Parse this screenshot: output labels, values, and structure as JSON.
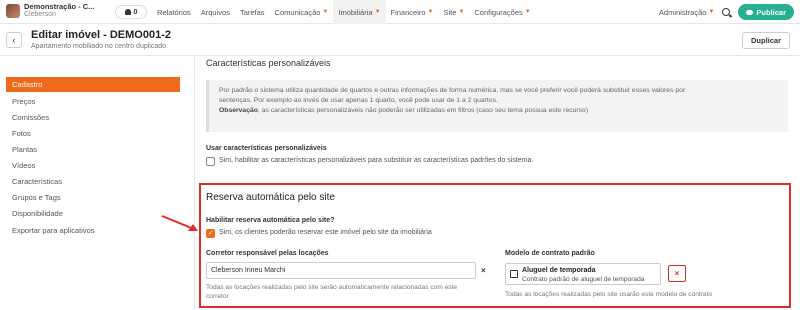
{
  "brand": {
    "title": "Demonstração - C...",
    "subtitle": "Cleberson"
  },
  "notifications": {
    "count": "0"
  },
  "menu": [
    {
      "label": "Relatórios",
      "dropdown": false,
      "active": false
    },
    {
      "label": "Arquivos",
      "dropdown": false,
      "active": false
    },
    {
      "label": "Tarefas",
      "dropdown": false,
      "active": false
    },
    {
      "label": "Comunicação",
      "dropdown": true,
      "active": false
    },
    {
      "label": "Imobiliária",
      "dropdown": true,
      "active": true
    },
    {
      "label": "Financeiro",
      "dropdown": true,
      "active": false
    },
    {
      "label": "Site",
      "dropdown": true,
      "active": false
    },
    {
      "label": "Configurações",
      "dropdown": true,
      "active": false
    }
  ],
  "admin": {
    "label": "Administração"
  },
  "publish": {
    "label": "Publicar"
  },
  "header": {
    "back": "‹",
    "title": "Editar imóvel - DEMO001-2",
    "subtitle": "Apartamento mobiliado no centro duplicado",
    "duplicate": "Duplicar"
  },
  "sidebar": {
    "items": [
      {
        "label": "Cadastro",
        "active": true
      },
      {
        "label": "Preços",
        "active": false
      },
      {
        "label": "Comissões",
        "active": false
      },
      {
        "label": "Fotos",
        "active": false
      },
      {
        "label": "Plantas",
        "active": false
      },
      {
        "label": "Vídeos",
        "active": false
      },
      {
        "label": "Características",
        "active": false
      },
      {
        "label": "Grupos e Tags",
        "active": false
      },
      {
        "label": "Disponibilidade",
        "active": false
      },
      {
        "label": "Exportar para aplicativos",
        "active": false
      }
    ]
  },
  "custom": {
    "section_title": "Características personalizáveis",
    "info_line1": "Por padrão o sistema utiliza quantidade de quartos e outras informações de forma numérica, mas se você preferir você poderá substituir esses valores por",
    "info_line2": "sentenças. Por exemplo ao invés de usar apenas 1 quarto, você pode usar de 1 a 2 quartos.",
    "info_obs_label": "Observação",
    "info_obs_text": ", as características personalizáveis não poderão ser utilizadas em filtros (caso seu tema possua este recurso)",
    "use_label": "Usar características personalizáveis",
    "use_checkbox": "Sim, habilitar as características personalizáveis para substituir as características padrões do sistema."
  },
  "reserva": {
    "title": "Reserva automática pelo site",
    "enable_label": "Habilitar reserva automática pelo site?",
    "enable_checkbox": "Sim, os clientes poderão reservar este imóvel pelo site da imobiliária",
    "broker_label": "Corretor responsável pelas locações",
    "broker_value": "Cleberson Irineu Marchi",
    "broker_clear": "×",
    "broker_help_line1": "Todas as locações realizadas pelo site serão automaticamente relacionadas com este",
    "broker_help_line2": "corretor",
    "contract_label": "Modelo de contrato padrão",
    "contract_name": "Aluguel de temporada",
    "contract_desc": "Contrato padrão de aluguel de temporada",
    "contract_remove": "×",
    "contract_help": "Todas as locações realizadas pelo site usarão este modelo de contrato"
  },
  "colors": {
    "accent": "#f06a1b",
    "publish": "#25b08f",
    "highlight": "#e12a2a"
  }
}
